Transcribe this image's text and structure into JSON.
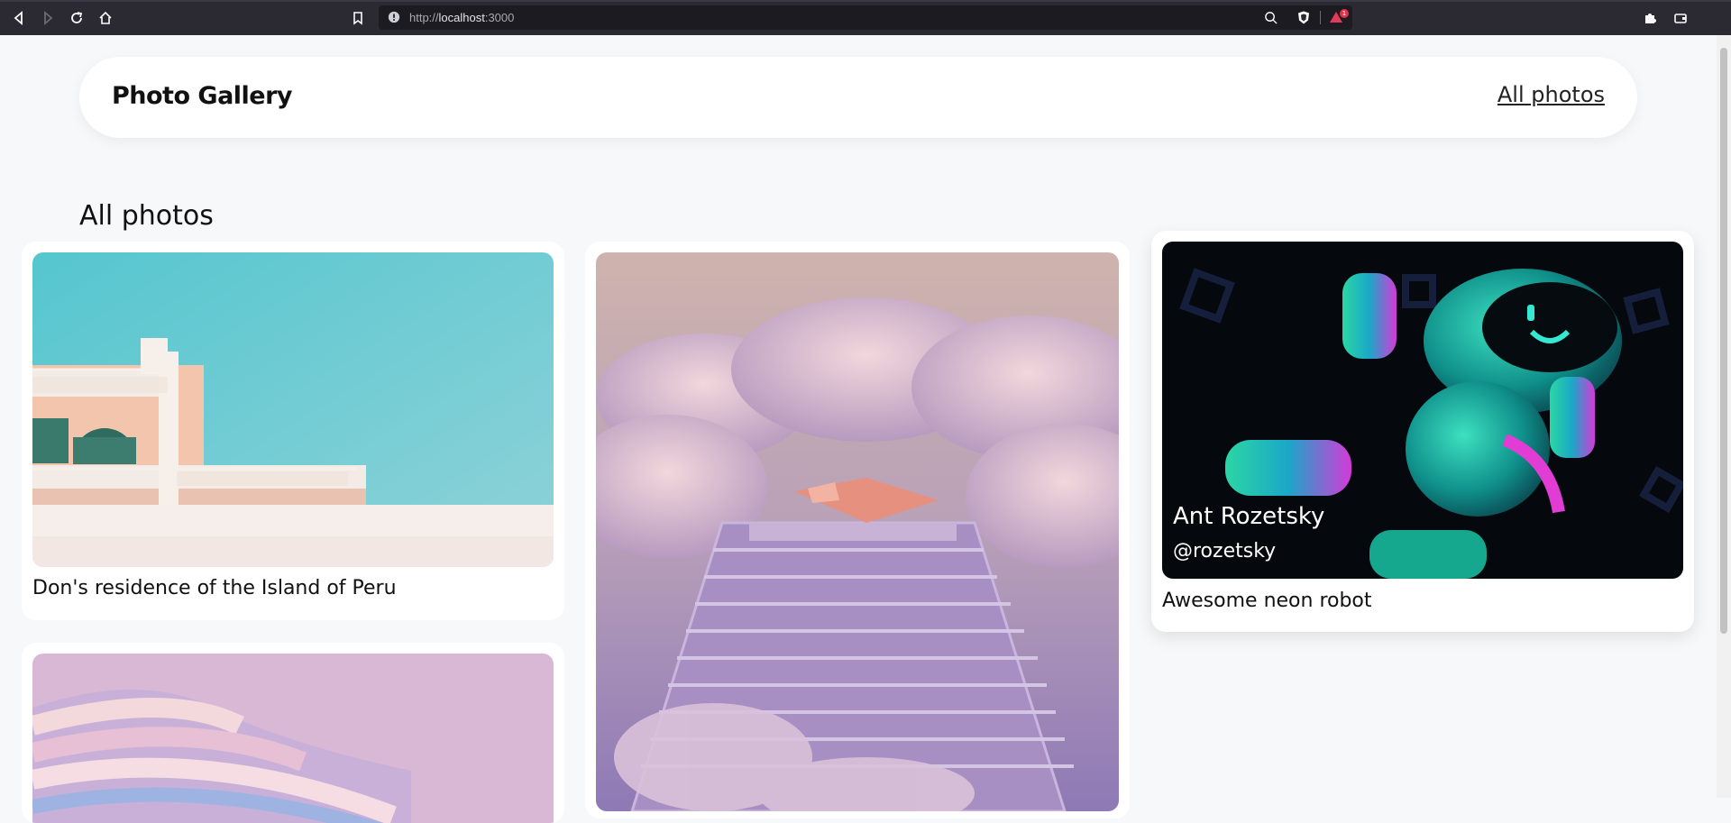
{
  "browser": {
    "url_scheme": "http://",
    "url_host": "localhost",
    "url_port": ":3000",
    "notification_count": "1"
  },
  "header": {
    "brand": "Photo Gallery",
    "nav_link": "All photos"
  },
  "page": {
    "heading": "All photos"
  },
  "photos": [
    {
      "caption": "Don's residence of the Island of Peru"
    },
    {
      "caption": ""
    },
    {
      "caption": "Awesome neon robot",
      "author_name": "Ant Rozetsky",
      "author_handle": "@rozetsky"
    },
    {
      "caption": ""
    }
  ],
  "colors": {
    "page_bg": "#f7f8fa",
    "card_bg": "#ffffff",
    "browser_bg": "#2b2a33"
  }
}
